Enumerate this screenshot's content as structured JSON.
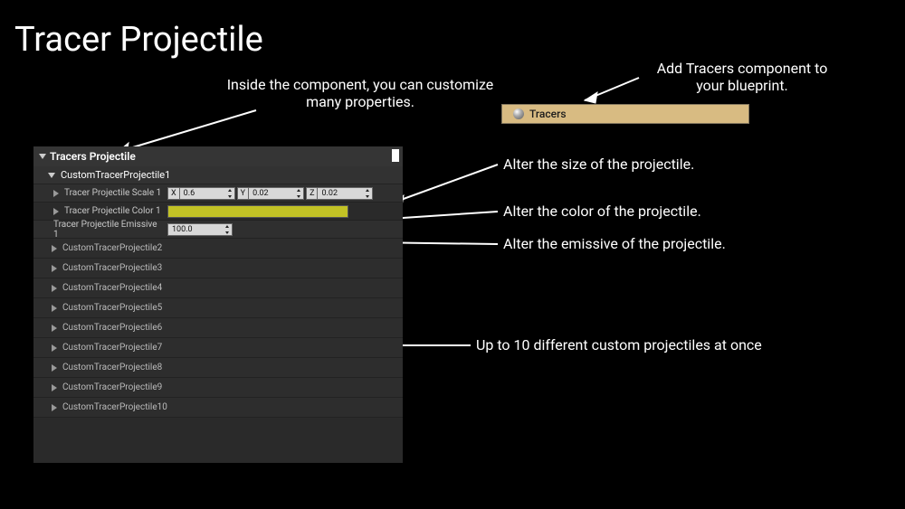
{
  "title": "Tracer Projectile",
  "annotations": {
    "customize": "Inside the component, you can customize many properties.",
    "add_component": "Add Tracers component to your blueprint.",
    "alter_size": "Alter the size of the projectile.",
    "alter_color": "Alter the color of the projectile.",
    "alter_emissive": "Alter the emissive of the projectile.",
    "up_to_ten": "Up to 10 different custom projectiles at once"
  },
  "tracers_badge": {
    "label": "Tracers"
  },
  "details_panel": {
    "header": "Tracers Projectile",
    "expanded_group": {
      "name": "CustomTracerProjectile1",
      "props": {
        "scale": {
          "label": "Tracer Projectile Scale 1",
          "x": "0.6",
          "y": "0.02",
          "z": "0.02"
        },
        "color": {
          "label": "Tracer Projectile Color 1",
          "hex": "#c2c225"
        },
        "emissive": {
          "label": "Tracer Projectile Emissive 1",
          "value": "100.0"
        }
      }
    },
    "collapsed_groups": [
      "CustomTracerProjectile2",
      "CustomTracerProjectile3",
      "CustomTracerProjectile4",
      "CustomTracerProjectile5",
      "CustomTracerProjectile6",
      "CustomTracerProjectile7",
      "CustomTracerProjectile8",
      "CustomTracerProjectile9",
      "CustomTracerProjectile10"
    ]
  }
}
